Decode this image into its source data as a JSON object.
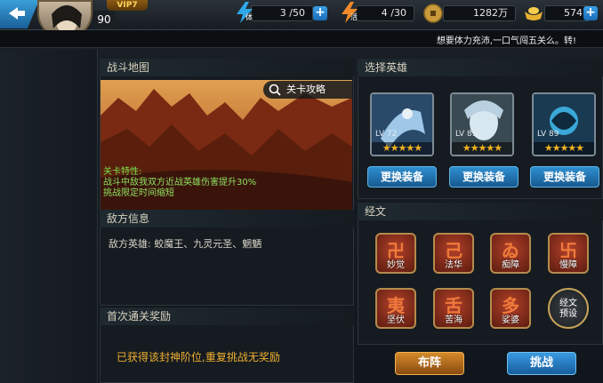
{
  "topbar": {
    "vip_label": "VIP7",
    "level": "90",
    "stamina": {
      "label": "体",
      "value": "3 /50"
    },
    "energy": {
      "label": "活",
      "value": "4 /30"
    },
    "coins": "1282万",
    "ingots": "574",
    "plus": "+"
  },
  "marquee": "想要体力充沛,一口气闯五关么。转!",
  "battle_map": {
    "title": "战斗地图",
    "strategy_button": "关卡攻略",
    "feature_title": "关卡特性:",
    "feature_line1": "战斗中敌我双方近战英雄伤害提升30%",
    "feature_line2": "挑战限定时间缩短"
  },
  "enemy_info": {
    "title": "敌方信息",
    "text": "敌方英雄: 蛟魔王、九灵元圣、魍魉"
  },
  "first_reward": {
    "title": "首次通关奖励",
    "text": "已获得该封神阶位,重复挑战无奖励"
  },
  "select_hero": {
    "title": "选择英雄",
    "heroes": [
      {
        "level": "LV 72",
        "stars": "★★★★★",
        "equip_label": "更换装备"
      },
      {
        "level": "LV 89",
        "stars": "★★★★★",
        "equip_label": "更换装备"
      },
      {
        "level": "LV 89",
        "stars": "★★★★★",
        "equip_label": "更换装备"
      }
    ]
  },
  "sutras": {
    "title": "经文",
    "items": [
      {
        "glyph": "卍",
        "name": "妙觉"
      },
      {
        "glyph": "己",
        "name": "法华"
      },
      {
        "glyph": "ゐ",
        "name": "痴障"
      },
      {
        "glyph": "卐",
        "name": "慢障"
      },
      {
        "glyph": "夷",
        "name": "坚伏"
      },
      {
        "glyph": "舌",
        "name": "苦海"
      },
      {
        "glyph": "多",
        "name": "娑婆"
      }
    ],
    "preset_line1": "经文",
    "preset_line2": "预设"
  },
  "actions": {
    "formation": "布阵",
    "challenge": "挑战"
  },
  "colors": {
    "accent_blue": "#2f8fd0",
    "feature_green": "#7be34a",
    "reward_orange": "#f0b030",
    "star_gold": "#f0b020"
  }
}
